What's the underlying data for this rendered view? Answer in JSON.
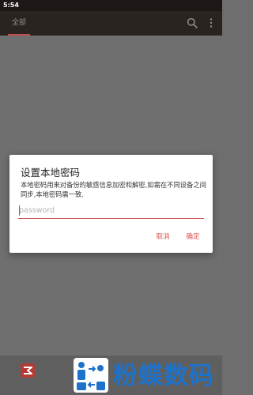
{
  "status_bar": {
    "time": "5:54"
  },
  "app_bar": {
    "tabs": [
      {
        "label": "全部",
        "selected": true
      }
    ],
    "actions": [
      "search-icon",
      "more-vert-icon"
    ]
  },
  "dialog": {
    "title": "设置本地密码",
    "message": "本地密码用来对备份的敏感信息加密和解密,如需在不同设备之间同步,本地密码需一致.",
    "input": {
      "value": "",
      "placeholder": "password"
    },
    "cancel_label": "取消",
    "ok_label": "确定"
  },
  "watermark": {
    "text": "粉蝶数码"
  },
  "colors": {
    "accent": "#d9534f",
    "appbar": "#2a2421",
    "scrim": "#6f6f6f",
    "watermark": "#1f72c9"
  }
}
